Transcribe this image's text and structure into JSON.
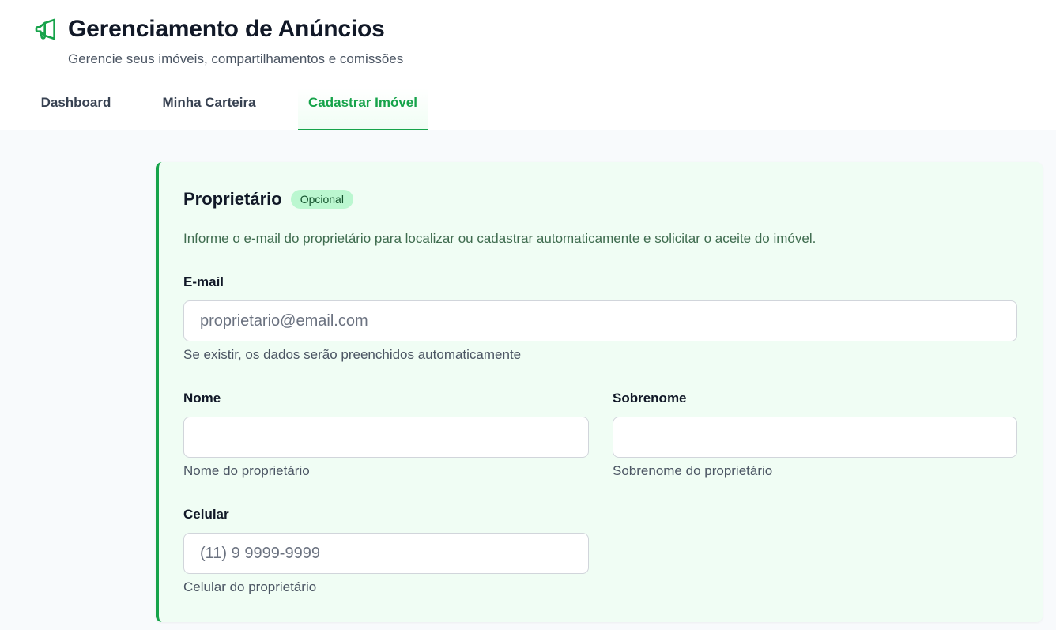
{
  "header": {
    "title": "Gerenciamento de Anúncios",
    "subtitle": "Gerencie seus imóveis, compartilhamentos e comissões",
    "icon": "megaphone-icon",
    "accent_color": "#16a34a"
  },
  "tabs": [
    {
      "label": "Dashboard",
      "active": false
    },
    {
      "label": "Minha Carteira",
      "active": false
    },
    {
      "label": "Cadastrar Imóvel",
      "active": true
    }
  ],
  "owner_section": {
    "title": "Proprietário",
    "badge": "Opcional",
    "description": "Informe o e-mail do proprietário para localizar ou cadastrar automaticamente e solicitar o aceite do imóvel.",
    "email": {
      "label": "E-mail",
      "value": "",
      "placeholder": "proprietario@email.com",
      "help": "Se existir, os dados serão preenchidos automaticamente"
    },
    "first_name": {
      "label": "Nome",
      "value": "",
      "placeholder": "",
      "help": "Nome do proprietário"
    },
    "last_name": {
      "label": "Sobrenome",
      "value": "",
      "placeholder": "",
      "help": "Sobrenome do proprietário"
    },
    "phone": {
      "label": "Celular",
      "value": "",
      "placeholder": "(11) 9 9999-9999",
      "help": "Celular do proprietário"
    }
  }
}
